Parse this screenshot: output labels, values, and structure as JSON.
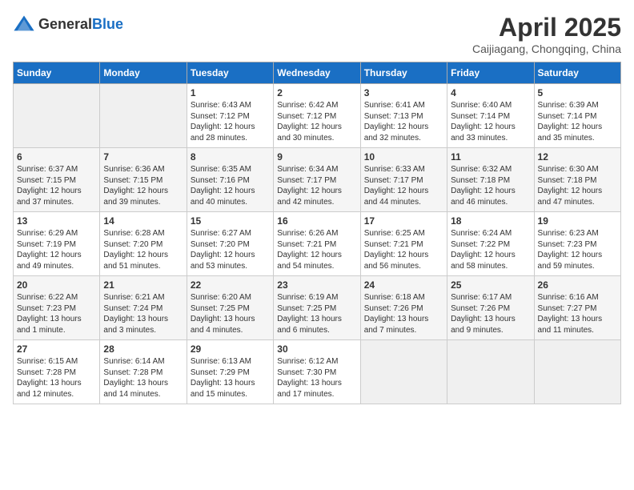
{
  "header": {
    "logo_general": "General",
    "logo_blue": "Blue",
    "month_title": "April 2025",
    "location": "Caijiagang, Chongqing, China"
  },
  "days_of_week": [
    "Sunday",
    "Monday",
    "Tuesday",
    "Wednesday",
    "Thursday",
    "Friday",
    "Saturday"
  ],
  "weeks": [
    [
      {
        "day": "",
        "info": ""
      },
      {
        "day": "",
        "info": ""
      },
      {
        "day": "1",
        "info": "Sunrise: 6:43 AM\nSunset: 7:12 PM\nDaylight: 12 hours and 28 minutes."
      },
      {
        "day": "2",
        "info": "Sunrise: 6:42 AM\nSunset: 7:12 PM\nDaylight: 12 hours and 30 minutes."
      },
      {
        "day": "3",
        "info": "Sunrise: 6:41 AM\nSunset: 7:13 PM\nDaylight: 12 hours and 32 minutes."
      },
      {
        "day": "4",
        "info": "Sunrise: 6:40 AM\nSunset: 7:14 PM\nDaylight: 12 hours and 33 minutes."
      },
      {
        "day": "5",
        "info": "Sunrise: 6:39 AM\nSunset: 7:14 PM\nDaylight: 12 hours and 35 minutes."
      }
    ],
    [
      {
        "day": "6",
        "info": "Sunrise: 6:37 AM\nSunset: 7:15 PM\nDaylight: 12 hours and 37 minutes."
      },
      {
        "day": "7",
        "info": "Sunrise: 6:36 AM\nSunset: 7:15 PM\nDaylight: 12 hours and 39 minutes."
      },
      {
        "day": "8",
        "info": "Sunrise: 6:35 AM\nSunset: 7:16 PM\nDaylight: 12 hours and 40 minutes."
      },
      {
        "day": "9",
        "info": "Sunrise: 6:34 AM\nSunset: 7:17 PM\nDaylight: 12 hours and 42 minutes."
      },
      {
        "day": "10",
        "info": "Sunrise: 6:33 AM\nSunset: 7:17 PM\nDaylight: 12 hours and 44 minutes."
      },
      {
        "day": "11",
        "info": "Sunrise: 6:32 AM\nSunset: 7:18 PM\nDaylight: 12 hours and 46 minutes."
      },
      {
        "day": "12",
        "info": "Sunrise: 6:30 AM\nSunset: 7:18 PM\nDaylight: 12 hours and 47 minutes."
      }
    ],
    [
      {
        "day": "13",
        "info": "Sunrise: 6:29 AM\nSunset: 7:19 PM\nDaylight: 12 hours and 49 minutes."
      },
      {
        "day": "14",
        "info": "Sunrise: 6:28 AM\nSunset: 7:20 PM\nDaylight: 12 hours and 51 minutes."
      },
      {
        "day": "15",
        "info": "Sunrise: 6:27 AM\nSunset: 7:20 PM\nDaylight: 12 hours and 53 minutes."
      },
      {
        "day": "16",
        "info": "Sunrise: 6:26 AM\nSunset: 7:21 PM\nDaylight: 12 hours and 54 minutes."
      },
      {
        "day": "17",
        "info": "Sunrise: 6:25 AM\nSunset: 7:21 PM\nDaylight: 12 hours and 56 minutes."
      },
      {
        "day": "18",
        "info": "Sunrise: 6:24 AM\nSunset: 7:22 PM\nDaylight: 12 hours and 58 minutes."
      },
      {
        "day": "19",
        "info": "Sunrise: 6:23 AM\nSunset: 7:23 PM\nDaylight: 12 hours and 59 minutes."
      }
    ],
    [
      {
        "day": "20",
        "info": "Sunrise: 6:22 AM\nSunset: 7:23 PM\nDaylight: 13 hours and 1 minute."
      },
      {
        "day": "21",
        "info": "Sunrise: 6:21 AM\nSunset: 7:24 PM\nDaylight: 13 hours and 3 minutes."
      },
      {
        "day": "22",
        "info": "Sunrise: 6:20 AM\nSunset: 7:25 PM\nDaylight: 13 hours and 4 minutes."
      },
      {
        "day": "23",
        "info": "Sunrise: 6:19 AM\nSunset: 7:25 PM\nDaylight: 13 hours and 6 minutes."
      },
      {
        "day": "24",
        "info": "Sunrise: 6:18 AM\nSunset: 7:26 PM\nDaylight: 13 hours and 7 minutes."
      },
      {
        "day": "25",
        "info": "Sunrise: 6:17 AM\nSunset: 7:26 PM\nDaylight: 13 hours and 9 minutes."
      },
      {
        "day": "26",
        "info": "Sunrise: 6:16 AM\nSunset: 7:27 PM\nDaylight: 13 hours and 11 minutes."
      }
    ],
    [
      {
        "day": "27",
        "info": "Sunrise: 6:15 AM\nSunset: 7:28 PM\nDaylight: 13 hours and 12 minutes."
      },
      {
        "day": "28",
        "info": "Sunrise: 6:14 AM\nSunset: 7:28 PM\nDaylight: 13 hours and 14 minutes."
      },
      {
        "day": "29",
        "info": "Sunrise: 6:13 AM\nSunset: 7:29 PM\nDaylight: 13 hours and 15 minutes."
      },
      {
        "day": "30",
        "info": "Sunrise: 6:12 AM\nSunset: 7:30 PM\nDaylight: 13 hours and 17 minutes."
      },
      {
        "day": "",
        "info": ""
      },
      {
        "day": "",
        "info": ""
      },
      {
        "day": "",
        "info": ""
      }
    ]
  ]
}
